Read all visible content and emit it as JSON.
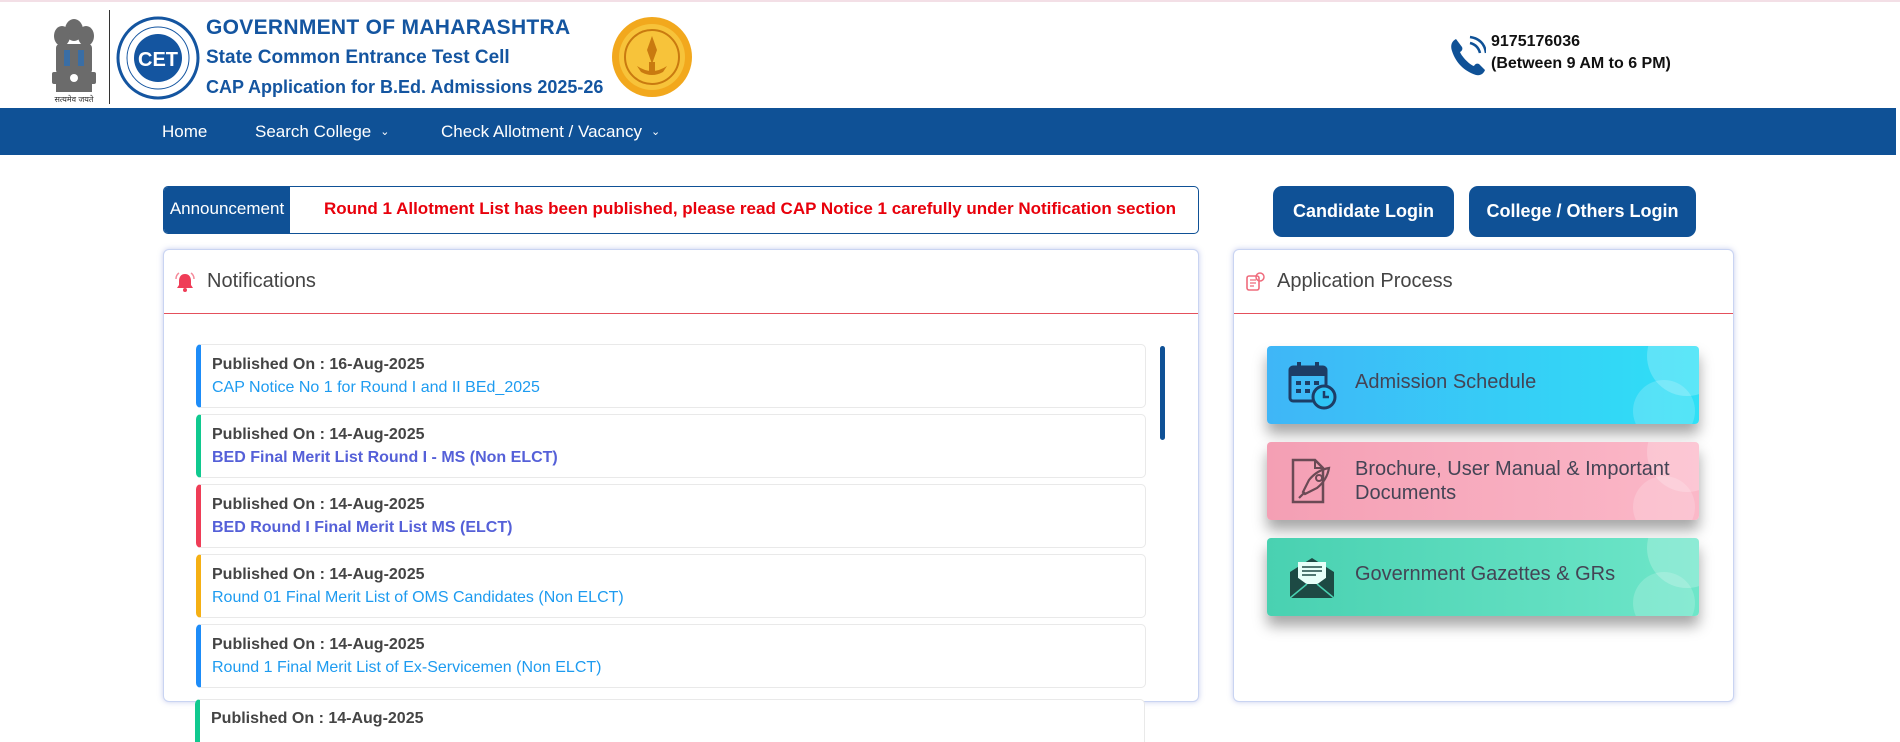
{
  "header": {
    "emblem_caption": "सत्यमेव जयते",
    "title_line1": "GOVERNMENT OF MAHARASHTRA",
    "title_line2": "State Common Entrance Test Cell",
    "title_line3": "CAP Application for B.Ed. Admissions 2025-26",
    "cet_logo_text": "CET",
    "phone": "9175176036",
    "phone_hours": "(Between 9 AM to 6 PM)"
  },
  "nav": {
    "items": [
      {
        "label": "Home"
      },
      {
        "label": "Search College"
      },
      {
        "label": "Check Allotment / Vacancy"
      }
    ]
  },
  "announcement": {
    "tag": "Announcement",
    "text": "Round 1 Allotment List has been published, please read CAP Notice 1 carefully under Notification section"
  },
  "login": {
    "candidate_label": "Candidate Login",
    "college_label": "College / Others Login"
  },
  "notifications": {
    "title": "Notifications",
    "items": [
      {
        "date": "Published On : 16-Aug-2025",
        "link": "CAP Notice No 1 for Round I and II BEd_2025",
        "accent": "#1d8cf8"
      },
      {
        "date": "Published On : 14-Aug-2025",
        "link": "BED Final Merit List Round I - MS (Non ELCT)",
        "accent": "#10c98f"
      },
      {
        "date": "Published On : 14-Aug-2025",
        "link": "BED Round I Final Merit List MS (ELCT)",
        "accent": "#ef3d57"
      },
      {
        "date": "Published On : 14-Aug-2025",
        "link": "Round 01 Final Merit List of OMS Candidates (Non ELCT)",
        "accent": "#f5b014"
      },
      {
        "date": "Published On : 14-Aug-2025",
        "link": "Round 1 Final Merit List of Ex-Servicemen (Non ELCT)",
        "accent": "#1d8cf8"
      },
      {
        "date": "Published On : 14-Aug-2025",
        "link": "",
        "accent": "#10c98f"
      }
    ]
  },
  "process": {
    "title": "Application Process",
    "cards": [
      {
        "label": "Admission Schedule",
        "icon": "calendar-clock-icon",
        "color_from": "#3fb6f7",
        "color_to": "#2fe0f6"
      },
      {
        "label": "Brochure, User Manual & Important Documents",
        "icon": "document-rocket-icon",
        "color_from": "#f49fb4",
        "color_to": "#fbb8c8"
      },
      {
        "label": "Government Gazettes & GRs",
        "icon": "open-envelope-icon",
        "color_from": "#49d1b1",
        "color_to": "#6ee6c9"
      }
    ]
  },
  "colors": {
    "primary": "#0f5196",
    "announcement_text": "#e8000b",
    "link": "#1d9bf0"
  }
}
